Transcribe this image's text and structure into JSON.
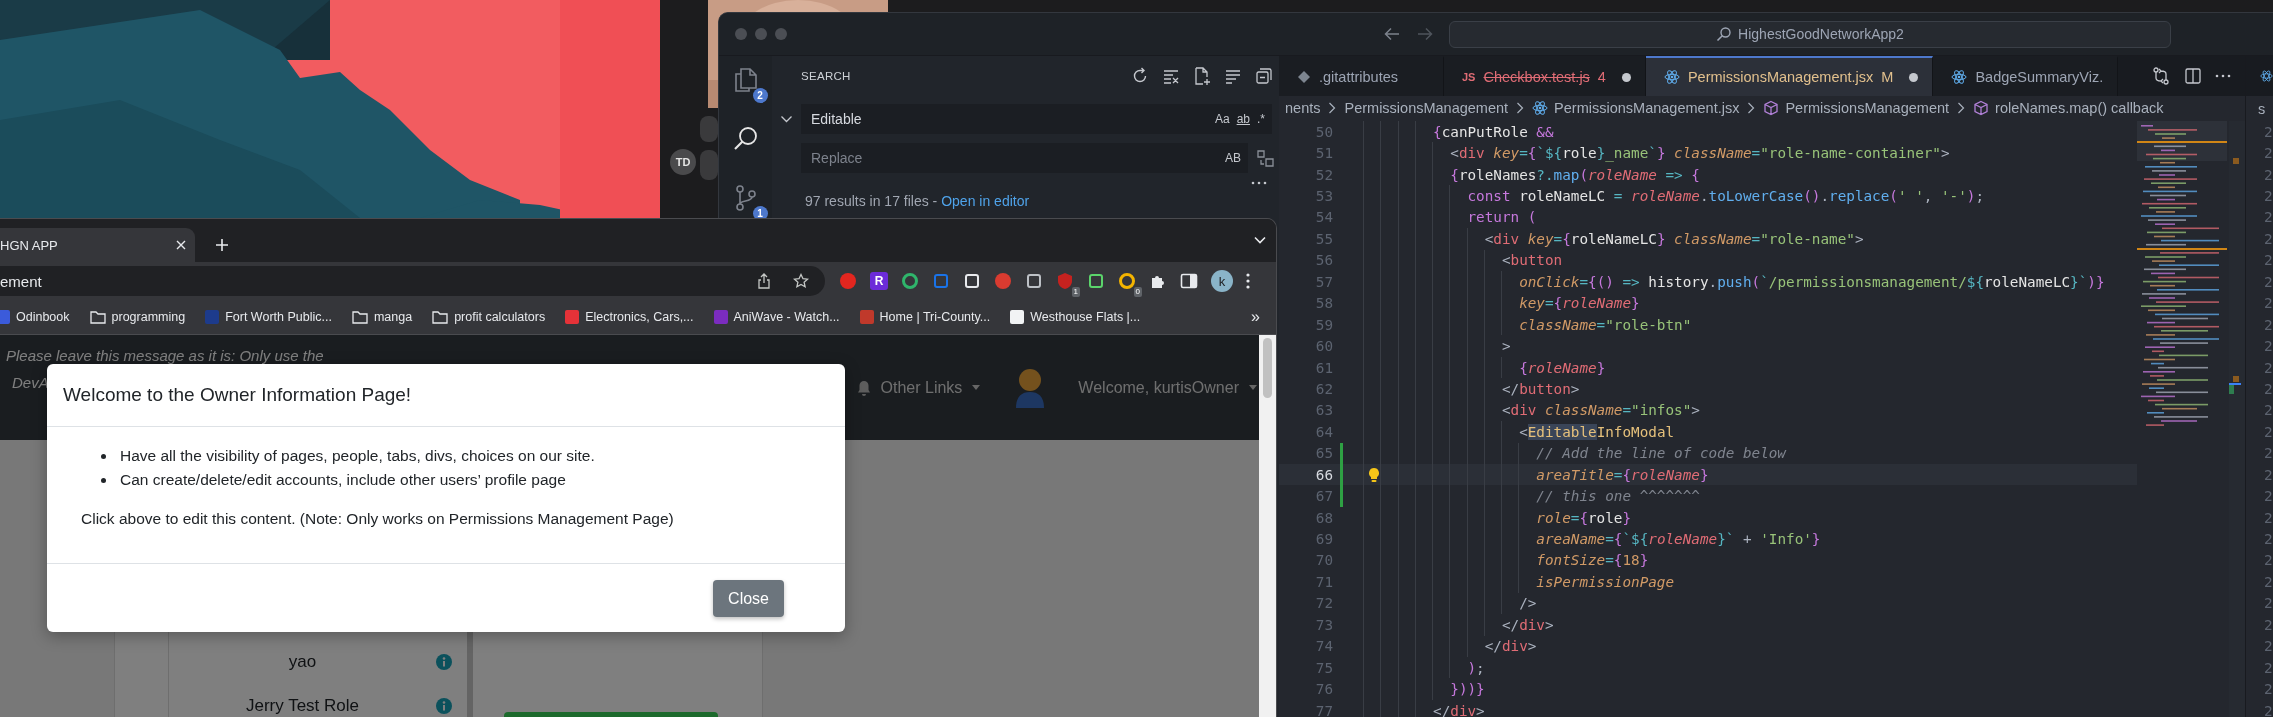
{
  "desktop": {
    "avatar_initials": "TD"
  },
  "vscode": {
    "title_search": "HighestGoodNetworkApp2",
    "activity": [
      {
        "kind": "files",
        "badge": "2",
        "selected": false
      },
      {
        "kind": "search",
        "selected": true
      },
      {
        "kind": "scm",
        "badge": "1",
        "selected": false
      }
    ],
    "search": {
      "title": "SEARCH",
      "find": "Editable",
      "find_options": [
        "Aa",
        "ab",
        ".*"
      ],
      "replace_placeholder": "Replace",
      "replace_option": "AB",
      "summary": "97 results in 17 files - ",
      "open_link": "Open in editor"
    },
    "tabs": [
      {
        "label": ".gitattributes",
        "kind": "git",
        "color": "#9da5b4",
        "deleted": false,
        "dirty": false,
        "selected": false
      },
      {
        "label": "Checkbox.test.js",
        "kind": "js",
        "icon_label": "JS",
        "color": "#e06c75",
        "badge": "4",
        "deleted": true,
        "dirty": true,
        "selected": false
      },
      {
        "label": "PermissionsManagement.jsx",
        "kind": "react",
        "color": "#e2c08d",
        "badge": "M",
        "deleted": false,
        "dirty": true,
        "selected": true
      },
      {
        "label": "BadgeSummaryViz.",
        "kind": "react",
        "color": "#9da5b4",
        "deleted": false,
        "dirty": false,
        "selected": false
      }
    ],
    "breadcrumb": [
      {
        "label": "nents",
        "kind": "plain"
      },
      {
        "label": "PermissionsManagement",
        "kind": "plain"
      },
      {
        "label": "PermissionsManagement.jsx",
        "kind": "react"
      },
      {
        "label": "PermissionsManagement",
        "kind": "symbol"
      },
      {
        "label": "roleNames.map() callback",
        "kind": "symbol"
      }
    ],
    "lines": [
      {
        "number": "50",
        "current": false,
        "modified": false,
        "tokens": [
          {
            "kind": "brace",
            "t": "          {"
          },
          {
            "kind": "ident",
            "t": "canPutRole "
          },
          {
            "kind": "keyword",
            "t": "&&"
          }
        ]
      },
      {
        "number": "51",
        "current": false,
        "modified": false,
        "tokens": [
          {
            "kind": "punct",
            "t": "            <"
          },
          {
            "kind": "tag",
            "t": "div"
          },
          {
            "kind": "attr",
            "t": " key"
          },
          {
            "kind": "operator",
            "t": "="
          },
          {
            "kind": "brace",
            "t": "{"
          },
          {
            "kind": "operator",
            "t": "`${"
          },
          {
            "kind": "ident",
            "t": "role"
          },
          {
            "kind": "operator",
            "t": "}"
          },
          {
            "kind": "string",
            "t": "_name"
          },
          {
            "kind": "operator",
            "t": "`"
          },
          {
            "kind": "brace",
            "t": "}"
          },
          {
            "kind": "attr",
            "t": " className"
          },
          {
            "kind": "operator",
            "t": "="
          },
          {
            "kind": "string",
            "t": "\"role-name-container\""
          },
          {
            "kind": "punct",
            "t": ">"
          }
        ]
      },
      {
        "number": "52",
        "current": false,
        "modified": false,
        "tokens": [
          {
            "kind": "brace",
            "t": "            {"
          },
          {
            "kind": "ident",
            "t": "roleNames"
          },
          {
            "kind": "operator",
            "t": "?."
          },
          {
            "kind": "func",
            "t": "map"
          },
          {
            "kind": "brace",
            "t": "("
          },
          {
            "kind": "param",
            "t": "roleName"
          },
          {
            "kind": "operator",
            "t": " =>"
          },
          {
            "kind": "brace",
            "t": " {"
          }
        ]
      },
      {
        "number": "53",
        "current": false,
        "modified": false,
        "tokens": [
          {
            "kind": "keyword",
            "t": "              const "
          },
          {
            "kind": "ident",
            "t": "roleNameLC "
          },
          {
            "kind": "operator",
            "t": "= "
          },
          {
            "kind": "param",
            "t": "roleName"
          },
          {
            "kind": "punct",
            "t": "."
          },
          {
            "kind": "func",
            "t": "toLowerCase"
          },
          {
            "kind": "brace",
            "t": "()"
          },
          {
            "kind": "punct",
            "t": "."
          },
          {
            "kind": "func",
            "t": "replace"
          },
          {
            "kind": "brace",
            "t": "("
          },
          {
            "kind": "string",
            "t": "' '"
          },
          {
            "kind": "punct",
            "t": ", "
          },
          {
            "kind": "string",
            "t": "'-'"
          },
          {
            "kind": "brace",
            "t": ")"
          },
          {
            "kind": "punct",
            "t": ";"
          }
        ]
      },
      {
        "number": "54",
        "current": false,
        "modified": false,
        "tokens": [
          {
            "kind": "keyword",
            "t": "              return "
          },
          {
            "kind": "brace",
            "t": "("
          }
        ]
      },
      {
        "number": "55",
        "current": false,
        "modified": false,
        "tokens": [
          {
            "kind": "punct",
            "t": "                <"
          },
          {
            "kind": "tag",
            "t": "div"
          },
          {
            "kind": "attr",
            "t": " key"
          },
          {
            "kind": "operator",
            "t": "="
          },
          {
            "kind": "brace",
            "t": "{"
          },
          {
            "kind": "ident",
            "t": "roleNameLC"
          },
          {
            "kind": "brace",
            "t": "}"
          },
          {
            "kind": "attr",
            "t": " className"
          },
          {
            "kind": "operator",
            "t": "="
          },
          {
            "kind": "string",
            "t": "\"role-name\""
          },
          {
            "kind": "punct",
            "t": ">"
          }
        ]
      },
      {
        "number": "56",
        "current": false,
        "modified": false,
        "tokens": [
          {
            "kind": "punct",
            "t": "                  <"
          },
          {
            "kind": "tag",
            "t": "button"
          }
        ]
      },
      {
        "number": "57",
        "current": false,
        "modified": false,
        "tokens": [
          {
            "kind": "attr",
            "t": "                    onClick"
          },
          {
            "kind": "operator",
            "t": "="
          },
          {
            "kind": "brace",
            "t": "{"
          },
          {
            "kind": "brace",
            "t": "()"
          },
          {
            "kind": "operator",
            "t": " =>"
          },
          {
            "kind": "ident",
            "t": " history"
          },
          {
            "kind": "punct",
            "t": "."
          },
          {
            "kind": "func",
            "t": "push"
          },
          {
            "kind": "brace",
            "t": "("
          },
          {
            "kind": "operator",
            "t": "`"
          },
          {
            "kind": "string",
            "t": "/permissionsmanagement/"
          },
          {
            "kind": "operator",
            "t": "${"
          },
          {
            "kind": "ident",
            "t": "roleNameLC"
          },
          {
            "kind": "operator",
            "t": "}`"
          },
          {
            "kind": "brace",
            "t": ")}"
          }
        ]
      },
      {
        "number": "58",
        "current": false,
        "modified": false,
        "tokens": [
          {
            "kind": "attr",
            "t": "                    key"
          },
          {
            "kind": "operator",
            "t": "="
          },
          {
            "kind": "brace",
            "t": "{"
          },
          {
            "kind": "param",
            "t": "roleName"
          },
          {
            "kind": "brace",
            "t": "}"
          }
        ]
      },
      {
        "number": "59",
        "current": false,
        "modified": false,
        "tokens": [
          {
            "kind": "attr",
            "t": "                    className"
          },
          {
            "kind": "operator",
            "t": "="
          },
          {
            "kind": "string",
            "t": "\"role-btn\""
          }
        ]
      },
      {
        "number": "60",
        "current": false,
        "modified": false,
        "tokens": [
          {
            "kind": "punct",
            "t": "                  >"
          }
        ]
      },
      {
        "number": "61",
        "current": false,
        "modified": false,
        "tokens": [
          {
            "kind": "brace",
            "t": "                    {"
          },
          {
            "kind": "param",
            "t": "roleName"
          },
          {
            "kind": "brace",
            "t": "}"
          }
        ]
      },
      {
        "number": "62",
        "current": false,
        "modified": false,
        "tokens": [
          {
            "kind": "punct",
            "t": "                  </"
          },
          {
            "kind": "tag",
            "t": "button"
          },
          {
            "kind": "punct",
            "t": ">"
          }
        ]
      },
      {
        "number": "63",
        "current": false,
        "modified": false,
        "tokens": [
          {
            "kind": "punct",
            "t": "                  <"
          },
          {
            "kind": "tag",
            "t": "div"
          },
          {
            "kind": "attr",
            "t": " className"
          },
          {
            "kind": "operator",
            "t": "="
          },
          {
            "kind": "string",
            "t": "\"infos\""
          },
          {
            "kind": "punct",
            "t": ">"
          }
        ]
      },
      {
        "number": "64",
        "current": false,
        "modified": false,
        "tokens": [
          {
            "kind": "punct",
            "t": "                    <"
          },
          {
            "kind": "match",
            "t": "Editable"
          },
          {
            "kind": "component",
            "t": "InfoModal"
          }
        ]
      },
      {
        "number": "65",
        "current": false,
        "modified": true,
        "tokens": [
          {
            "kind": "comment",
            "t": "                      // Add the line of code below"
          }
        ]
      },
      {
        "number": "66",
        "current": true,
        "modified": true,
        "tokens": [
          {
            "kind": "attr",
            "t": "                      areaTitle"
          },
          {
            "kind": "operator",
            "t": "="
          },
          {
            "kind": "brace",
            "t": "{"
          },
          {
            "kind": "param",
            "t": "roleName"
          },
          {
            "kind": "brace",
            "t": "}"
          }
        ]
      },
      {
        "number": "67",
        "current": false,
        "modified": true,
        "tokens": [
          {
            "kind": "comment",
            "t": "                      // this one ^^^^^^^"
          }
        ]
      },
      {
        "number": "68",
        "current": false,
        "modified": false,
        "tokens": [
          {
            "kind": "attr",
            "t": "                      role"
          },
          {
            "kind": "operator",
            "t": "="
          },
          {
            "kind": "brace",
            "t": "{"
          },
          {
            "kind": "ident",
            "t": "role"
          },
          {
            "kind": "brace",
            "t": "}"
          }
        ]
      },
      {
        "number": "69",
        "current": false,
        "modified": false,
        "tokens": [
          {
            "kind": "attr",
            "t": "                      areaName"
          },
          {
            "kind": "operator",
            "t": "="
          },
          {
            "kind": "brace",
            "t": "{"
          },
          {
            "kind": "operator",
            "t": "`${"
          },
          {
            "kind": "param",
            "t": "roleName"
          },
          {
            "kind": "operator",
            "t": "}`"
          },
          {
            "kind": "punct",
            "t": " + "
          },
          {
            "kind": "string",
            "t": "'Info'"
          },
          {
            "kind": "brace",
            "t": "}"
          }
        ]
      },
      {
        "number": "70",
        "current": false,
        "modified": false,
        "tokens": [
          {
            "kind": "attr",
            "t": "                      fontSize"
          },
          {
            "kind": "operator",
            "t": "="
          },
          {
            "kind": "brace",
            "t": "{"
          },
          {
            "kind": "number",
            "t": "18"
          },
          {
            "kind": "brace",
            "t": "}"
          }
        ]
      },
      {
        "number": "71",
        "current": false,
        "modified": false,
        "tokens": [
          {
            "kind": "attr",
            "t": "                      isPermissionPage"
          }
        ]
      },
      {
        "number": "72",
        "current": false,
        "modified": false,
        "tokens": [
          {
            "kind": "punct",
            "t": "                    />"
          }
        ]
      },
      {
        "number": "73",
        "current": false,
        "modified": false,
        "tokens": [
          {
            "kind": "punct",
            "t": "                  </"
          },
          {
            "kind": "tag",
            "t": "div"
          },
          {
            "kind": "punct",
            "t": ">"
          }
        ]
      },
      {
        "number": "74",
        "current": false,
        "modified": false,
        "tokens": [
          {
            "kind": "punct",
            "t": "                </"
          },
          {
            "kind": "tag",
            "t": "div"
          },
          {
            "kind": "punct",
            "t": ">"
          }
        ]
      },
      {
        "number": "75",
        "current": false,
        "modified": false,
        "tokens": [
          {
            "kind": "brace",
            "t": "              )"
          },
          {
            "kind": "punct",
            "t": ";"
          }
        ]
      },
      {
        "number": "76",
        "current": false,
        "modified": false,
        "tokens": [
          {
            "kind": "brace",
            "t": "            })"
          },
          {
            "kind": "brace",
            "t": ")}"
          }
        ]
      },
      {
        "number": "77",
        "current": false,
        "modified": false,
        "tokens": [
          {
            "kind": "punct",
            "t": "          </"
          },
          {
            "kind": "tag",
            "t": "div"
          },
          {
            "kind": "punct",
            "t": ">"
          }
        ]
      }
    ],
    "second_editor": {
      "breadcrumb": "s",
      "line_numbers": [
        "2",
        "2",
        "2",
        "2",
        "2",
        "2",
        "2",
        "2",
        "2",
        "2",
        "2",
        "2",
        "2",
        "2",
        "2",
        "2",
        "2",
        "2",
        "2",
        "2",
        "2",
        "2",
        "2",
        "2",
        "2",
        "2",
        "2",
        "2"
      ]
    }
  },
  "browser": {
    "tab": {
      "title": "HGN APP",
      "selected": true
    },
    "address": "ement",
    "extensions": [
      {
        "kind": "dot",
        "color": "#e3261f"
      },
      {
        "kind": "letter",
        "color": "#6c2bd9",
        "label": "R"
      },
      {
        "kind": "ring",
        "color": "#2fb56b"
      },
      {
        "kind": "glyph",
        "color": "#1a73e8"
      },
      {
        "kind": "glyph",
        "color": "#e8eaed"
      },
      {
        "kind": "dot",
        "color": "#d93b30"
      },
      {
        "kind": "glyph",
        "color": "#bdc1c6"
      },
      {
        "kind": "shield",
        "color": "#c5221f",
        "badge": "1"
      },
      {
        "kind": "glyph",
        "color": "#5bd46b"
      },
      {
        "kind": "ring",
        "color": "#f4b400",
        "badge": "0"
      }
    ],
    "profile": "k",
    "bookmarks": [
      {
        "label": "Odinbook",
        "kind": "site",
        "color": "#3b5bdb"
      },
      {
        "label": "programming",
        "kind": "folder"
      },
      {
        "label": "Fort Worth Public...",
        "kind": "site",
        "color": "#1d3b8c"
      },
      {
        "label": "manga",
        "kind": "folder"
      },
      {
        "label": "profit calculators",
        "kind": "folder"
      },
      {
        "label": "Electronics, Cars,...",
        "kind": "site",
        "color": "#e53238"
      },
      {
        "label": "AniWave - Watch...",
        "kind": "site",
        "color": "#7b2cbf"
      },
      {
        "label": "Home | Tri-County...",
        "kind": "site",
        "color": "#c0392b"
      },
      {
        "label": "Westhouse Flats |...",
        "kind": "site",
        "color": "#f1f3f4"
      }
    ],
    "bookmarks_more": "»",
    "page": {
      "notice": [
        "Please leave this message as it is: Only use the",
        "DevA"
      ],
      "nav_link": "Other Links",
      "welcome": "Welcome, kurtisOwner",
      "roles": [
        {
          "label": "yao"
        },
        {
          "label": "Jerry Test Role"
        }
      ]
    },
    "modal": {
      "title": "Welcome to the Owner Information Page!",
      "bullets": [
        "Have all the visibility of pages, people, tabs, divs, choices on our site.",
        "Can create/delete/edit accounts, include other users’ profile page"
      ],
      "note": "Click above to edit this content. (Note: Only works on Permissions Management Page)",
      "close": "Close"
    }
  }
}
